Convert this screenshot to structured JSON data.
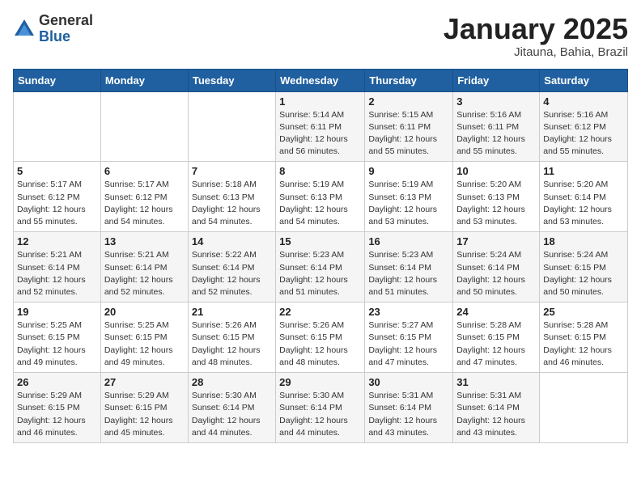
{
  "logo": {
    "general": "General",
    "blue": "Blue"
  },
  "title": "January 2025",
  "subtitle": "Jitauna, Bahia, Brazil",
  "header_days": [
    "Sunday",
    "Monday",
    "Tuesday",
    "Wednesday",
    "Thursday",
    "Friday",
    "Saturday"
  ],
  "weeks": [
    [
      {
        "day": "",
        "info": ""
      },
      {
        "day": "",
        "info": ""
      },
      {
        "day": "",
        "info": ""
      },
      {
        "day": "1",
        "info": "Sunrise: 5:14 AM\nSunset: 6:11 PM\nDaylight: 12 hours and 56 minutes."
      },
      {
        "day": "2",
        "info": "Sunrise: 5:15 AM\nSunset: 6:11 PM\nDaylight: 12 hours and 55 minutes."
      },
      {
        "day": "3",
        "info": "Sunrise: 5:16 AM\nSunset: 6:11 PM\nDaylight: 12 hours and 55 minutes."
      },
      {
        "day": "4",
        "info": "Sunrise: 5:16 AM\nSunset: 6:12 PM\nDaylight: 12 hours and 55 minutes."
      }
    ],
    [
      {
        "day": "5",
        "info": "Sunrise: 5:17 AM\nSunset: 6:12 PM\nDaylight: 12 hours and 55 minutes."
      },
      {
        "day": "6",
        "info": "Sunrise: 5:17 AM\nSunset: 6:12 PM\nDaylight: 12 hours and 54 minutes."
      },
      {
        "day": "7",
        "info": "Sunrise: 5:18 AM\nSunset: 6:13 PM\nDaylight: 12 hours and 54 minutes."
      },
      {
        "day": "8",
        "info": "Sunrise: 5:19 AM\nSunset: 6:13 PM\nDaylight: 12 hours and 54 minutes."
      },
      {
        "day": "9",
        "info": "Sunrise: 5:19 AM\nSunset: 6:13 PM\nDaylight: 12 hours and 53 minutes."
      },
      {
        "day": "10",
        "info": "Sunrise: 5:20 AM\nSunset: 6:13 PM\nDaylight: 12 hours and 53 minutes."
      },
      {
        "day": "11",
        "info": "Sunrise: 5:20 AM\nSunset: 6:14 PM\nDaylight: 12 hours and 53 minutes."
      }
    ],
    [
      {
        "day": "12",
        "info": "Sunrise: 5:21 AM\nSunset: 6:14 PM\nDaylight: 12 hours and 52 minutes."
      },
      {
        "day": "13",
        "info": "Sunrise: 5:21 AM\nSunset: 6:14 PM\nDaylight: 12 hours and 52 minutes."
      },
      {
        "day": "14",
        "info": "Sunrise: 5:22 AM\nSunset: 6:14 PM\nDaylight: 12 hours and 52 minutes."
      },
      {
        "day": "15",
        "info": "Sunrise: 5:23 AM\nSunset: 6:14 PM\nDaylight: 12 hours and 51 minutes."
      },
      {
        "day": "16",
        "info": "Sunrise: 5:23 AM\nSunset: 6:14 PM\nDaylight: 12 hours and 51 minutes."
      },
      {
        "day": "17",
        "info": "Sunrise: 5:24 AM\nSunset: 6:14 PM\nDaylight: 12 hours and 50 minutes."
      },
      {
        "day": "18",
        "info": "Sunrise: 5:24 AM\nSunset: 6:15 PM\nDaylight: 12 hours and 50 minutes."
      }
    ],
    [
      {
        "day": "19",
        "info": "Sunrise: 5:25 AM\nSunset: 6:15 PM\nDaylight: 12 hours and 49 minutes."
      },
      {
        "day": "20",
        "info": "Sunrise: 5:25 AM\nSunset: 6:15 PM\nDaylight: 12 hours and 49 minutes."
      },
      {
        "day": "21",
        "info": "Sunrise: 5:26 AM\nSunset: 6:15 PM\nDaylight: 12 hours and 48 minutes."
      },
      {
        "day": "22",
        "info": "Sunrise: 5:26 AM\nSunset: 6:15 PM\nDaylight: 12 hours and 48 minutes."
      },
      {
        "day": "23",
        "info": "Sunrise: 5:27 AM\nSunset: 6:15 PM\nDaylight: 12 hours and 47 minutes."
      },
      {
        "day": "24",
        "info": "Sunrise: 5:28 AM\nSunset: 6:15 PM\nDaylight: 12 hours and 47 minutes."
      },
      {
        "day": "25",
        "info": "Sunrise: 5:28 AM\nSunset: 6:15 PM\nDaylight: 12 hours and 46 minutes."
      }
    ],
    [
      {
        "day": "26",
        "info": "Sunrise: 5:29 AM\nSunset: 6:15 PM\nDaylight: 12 hours and 46 minutes."
      },
      {
        "day": "27",
        "info": "Sunrise: 5:29 AM\nSunset: 6:15 PM\nDaylight: 12 hours and 45 minutes."
      },
      {
        "day": "28",
        "info": "Sunrise: 5:30 AM\nSunset: 6:14 PM\nDaylight: 12 hours and 44 minutes."
      },
      {
        "day": "29",
        "info": "Sunrise: 5:30 AM\nSunset: 6:14 PM\nDaylight: 12 hours and 44 minutes."
      },
      {
        "day": "30",
        "info": "Sunrise: 5:31 AM\nSunset: 6:14 PM\nDaylight: 12 hours and 43 minutes."
      },
      {
        "day": "31",
        "info": "Sunrise: 5:31 AM\nSunset: 6:14 PM\nDaylight: 12 hours and 43 minutes."
      },
      {
        "day": "",
        "info": ""
      }
    ]
  ]
}
